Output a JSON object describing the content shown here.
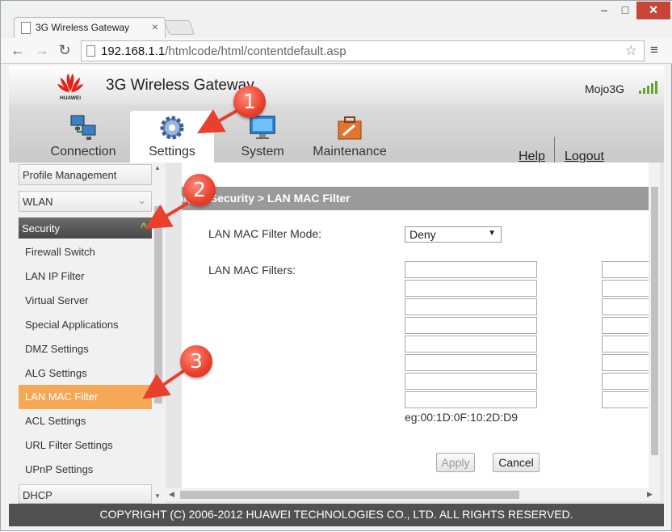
{
  "browser": {
    "tab_title": "3G Wireless Gateway",
    "tab_close": "×",
    "url_host": "192.168.1.1",
    "url_path": "/htmlcode/html/contentdefault.asp",
    "back_icon": "←",
    "forward_icon": "→",
    "reload_icon": "↻",
    "star_icon": "☆",
    "menu_icon": "≡",
    "min_icon": "–",
    "max_icon": "□",
    "close_icon": "✕"
  },
  "header": {
    "logo_text": "HUAWEI",
    "title": "3G Wireless Gateway",
    "device_name": "Mojo3G",
    "signal_bars": 5
  },
  "nav": {
    "tabs": [
      {
        "label": "Connection",
        "icon": "connection-icon"
      },
      {
        "label": "Settings",
        "icon": "gear-icon",
        "active": true
      },
      {
        "label": "System",
        "icon": "monitor-icon"
      },
      {
        "label": "Maintenance",
        "icon": "toolbox-icon"
      }
    ],
    "help": "Help",
    "logout": "Logout"
  },
  "sidebar": {
    "groups": [
      "Profile Management",
      "WLAN",
      "Security",
      "DHCP"
    ],
    "items": [
      {
        "label": "Firewall Switch"
      },
      {
        "label": "LAN IP Filter"
      },
      {
        "label": "Virtual Server"
      },
      {
        "label": "Special Applications"
      },
      {
        "label": "DMZ Settings"
      },
      {
        "label": "ALG Settings"
      },
      {
        "label": "LAN MAC Filter",
        "active": true
      },
      {
        "label": "ACL Settings"
      },
      {
        "label": "URL Filter Settings"
      },
      {
        "label": "UPnP Settings"
      }
    ],
    "expanded_chevron": "^",
    "collapsed_chevron": "v"
  },
  "content": {
    "breadcrumb": "ings > Security > LAN MAC Filter",
    "mode_label": "LAN MAC Filter Mode:",
    "mode_value": "Deny",
    "filters_label": "LAN MAC Filters:",
    "example": "eg:00:1D:0F:10:2D:D9",
    "apply": "Apply",
    "cancel": "Cancel"
  },
  "footer": {
    "text": "COPYRIGHT (C) 2006-2012 HUAWEI TECHNOLOGIES CO., LTD. ALL RIGHTS RESERVED."
  },
  "annotations": [
    "1",
    "2",
    "3"
  ],
  "colors": {
    "active_menu": "#f5a855",
    "security_header": "#555555",
    "breadcrumb_bar": "#9a9a9a",
    "callout": "#e8402c",
    "footer": "#515151"
  }
}
